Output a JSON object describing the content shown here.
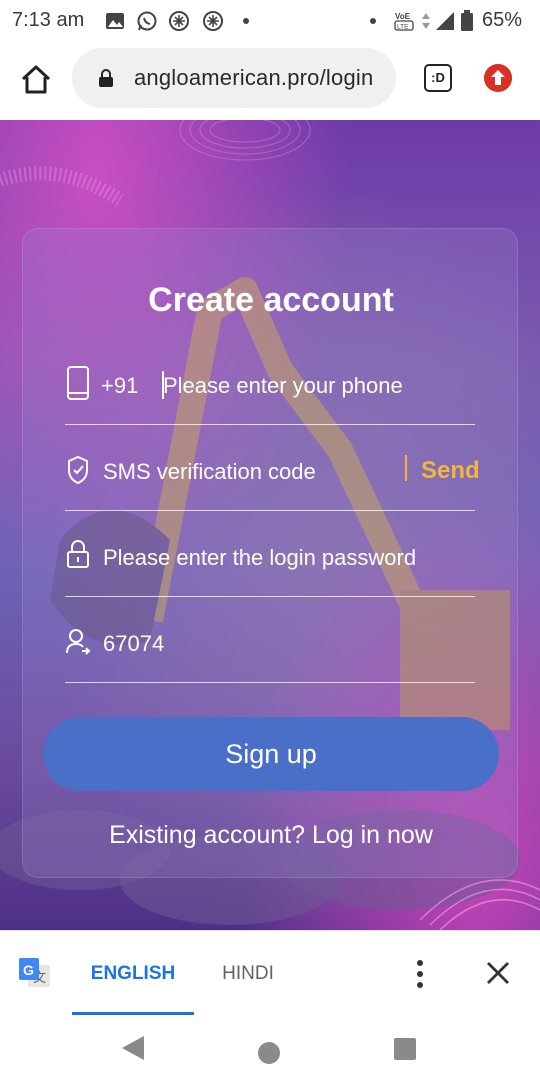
{
  "status_bar": {
    "time": "7:13 am",
    "battery": "65%",
    "icons": [
      "gallery-icon",
      "whatsapp-icon",
      "app-icon",
      "app-icon",
      "dot-icon",
      "dot-icon",
      "volte-icon",
      "data-arrows-icon",
      "signal-icon",
      "battery-icon"
    ],
    "volte_label": "VoLTE"
  },
  "browser": {
    "url": "angloamerican.pro/login",
    "tabs_label": ":D"
  },
  "form": {
    "title": "Create account",
    "phone_prefix": "+91",
    "phone_placeholder": "Please enter your phone",
    "sms_placeholder": "SMS verification code",
    "send_label": "Send",
    "password_placeholder": "Please enter the login password",
    "invite_code": "67074",
    "signup_label": "Sign up",
    "login_link": "Existing account? Log in now"
  },
  "translate_bar": {
    "tabs": [
      {
        "label": "ENGLISH",
        "active": true
      },
      {
        "label": "HINDI",
        "active": false
      }
    ]
  },
  "colors": {
    "accent_send": "#f4b53c",
    "signup_button": "#4a6fc9",
    "translate_active": "#1a73e8"
  }
}
